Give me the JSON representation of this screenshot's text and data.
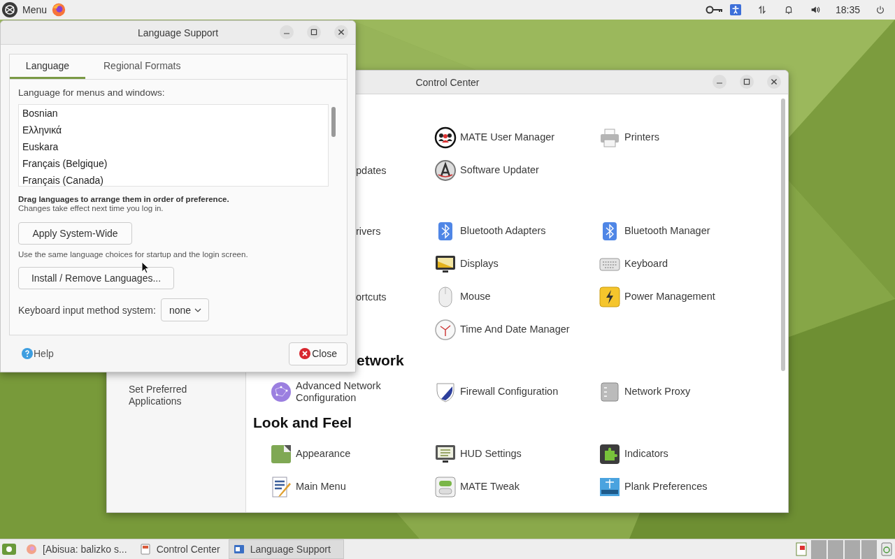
{
  "top_panel": {
    "menu_label": "Menu",
    "clock": "18:35"
  },
  "control_center": {
    "title": "Control Center",
    "sidebar_items": [
      "Set Preferred Applications"
    ],
    "rows": [
      {
        "kind": "items",
        "column_2": {
          "kind": "app",
          "label": "MATE User Manager"
        },
        "column_3": {
          "kind": "app",
          "label": "Printers"
        }
      },
      {
        "kind": "items",
        "column_1": {
          "kind": "clipped",
          "label": "pdates"
        },
        "column_2": {
          "kind": "app",
          "label": "Software Updater"
        }
      },
      {
        "kind": "items",
        "column_1": {
          "kind": "clipped",
          "label": "rivers"
        },
        "column_2": {
          "kind": "app",
          "label": "Bluetooth Adapters"
        },
        "column_3": {
          "kind": "app",
          "label": "Bluetooth Manager"
        }
      },
      {
        "kind": "items",
        "column_2": {
          "kind": "app",
          "label": "Displays"
        },
        "column_3": {
          "kind": "app",
          "label": "Keyboard"
        }
      },
      {
        "kind": "items",
        "column_1": {
          "kind": "clipped",
          "label": "ortcuts"
        },
        "column_2": {
          "kind": "app",
          "label": "Mouse"
        },
        "column_3": {
          "kind": "app",
          "label": "Power Management"
        }
      },
      {
        "kind": "items",
        "column_2": {
          "kind": "app",
          "label": "Time And Date Manager"
        }
      },
      {
        "kind": "clipped_heading",
        "label": "etwork"
      },
      {
        "kind": "items",
        "column_1": {
          "kind": "app",
          "label": "Advanced Network Configuration"
        },
        "column_2": {
          "kind": "app",
          "label": "Firewall Configuration"
        },
        "column_3": {
          "kind": "app",
          "label": "Network Proxy"
        }
      },
      {
        "kind": "heading",
        "label": "Look and Feel"
      },
      {
        "kind": "items",
        "column_1": {
          "kind": "app",
          "label": "Appearance"
        },
        "column_2": {
          "kind": "app",
          "label": "HUD Settings"
        },
        "column_3": {
          "kind": "app",
          "label": "Indicators"
        }
      },
      {
        "kind": "items",
        "column_1": {
          "kind": "app",
          "label": "Main Menu"
        },
        "column_2": {
          "kind": "app",
          "label": "MATE Tweak"
        },
        "column_3": {
          "kind": "app",
          "label": "Plank Preferences"
        }
      }
    ]
  },
  "language_support": {
    "title": "Language Support",
    "tabs": [
      {
        "label": "Language",
        "selected": true
      },
      {
        "label": "Regional Formats",
        "selected": false
      }
    ],
    "list_label": "Language for menus and windows:",
    "languages": [
      "Bosnian",
      "Ελληνικά",
      "Euskara",
      "Français (Belgique)",
      "Français (Canada)"
    ],
    "drag_hint": "Drag languages to arrange them in order of preference.",
    "drag_note": "Changes take effect next time you log in.",
    "apply_button": "Apply System-Wide",
    "apply_note": "Use the same language choices for startup and the login screen.",
    "install_button": "Install / Remove Languages...",
    "input_method_label": "Keyboard input method system:",
    "input_method_value": "none",
    "help": "Help",
    "close_button": "Close"
  },
  "taskbar": {
    "items": [
      {
        "label": "[Abisua: balizko s...",
        "selected": false
      },
      {
        "label": "Control Center",
        "selected": false
      },
      {
        "label": "Language Support",
        "selected": true
      }
    ]
  }
}
